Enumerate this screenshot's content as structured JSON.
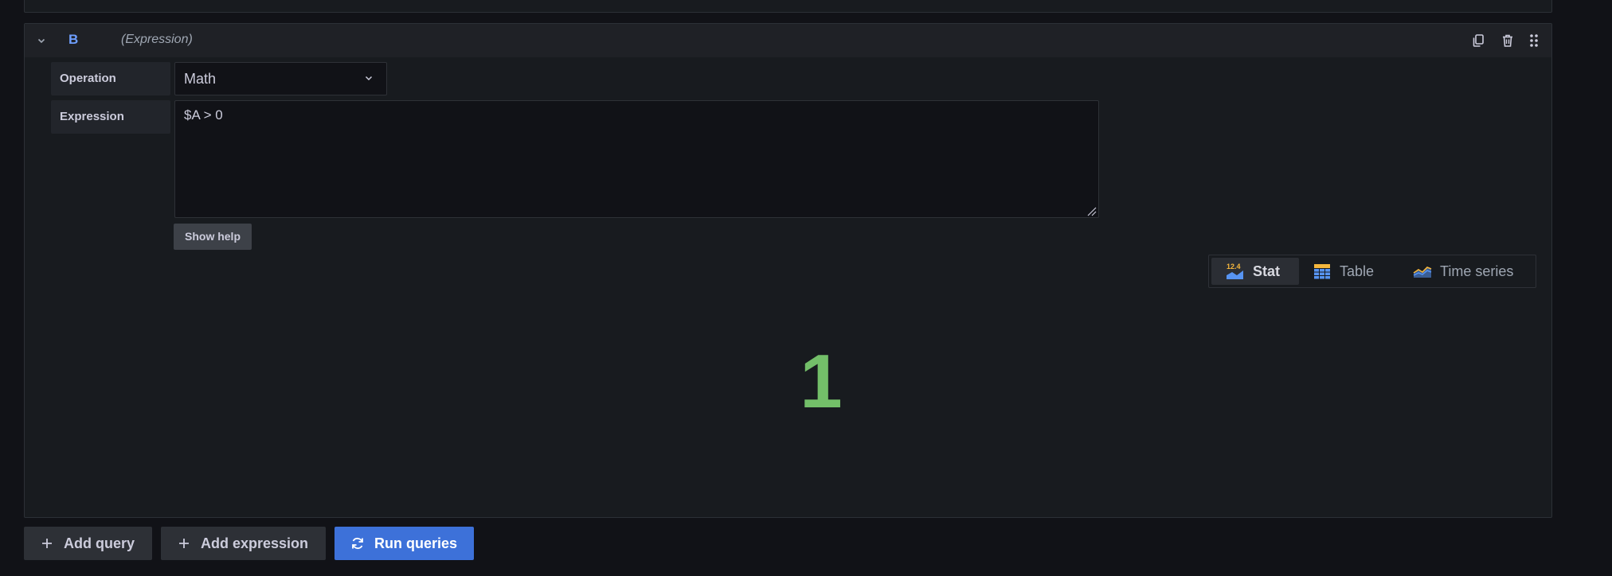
{
  "query": {
    "ref_id": "B",
    "type_label": "(Expression)",
    "header_icons": [
      "duplicate-icon",
      "trash-icon",
      "drag-handle-icon"
    ]
  },
  "expression_editor": {
    "operation_label": "Operation",
    "operation_value": "Math",
    "expression_label": "Expression",
    "expression_value": "$A > 0",
    "show_help_label": "Show help"
  },
  "viz_options": [
    {
      "label": "Stat",
      "icon": "stat-icon",
      "active": true
    },
    {
      "label": "Table",
      "icon": "table-icon",
      "active": false
    },
    {
      "label": "Time series",
      "icon": "time-series-icon",
      "active": false
    }
  ],
  "result": {
    "stat_value": "1",
    "stat_color": "#73bf69"
  },
  "actions": {
    "add_query_label": "Add query",
    "add_expression_label": "Add expression",
    "run_queries_label": "Run queries"
  },
  "colors": {
    "accent_blue": "#6e9fff",
    "primary_button": "#3d71d9",
    "background": "#111217",
    "panel": "#181b1f"
  }
}
